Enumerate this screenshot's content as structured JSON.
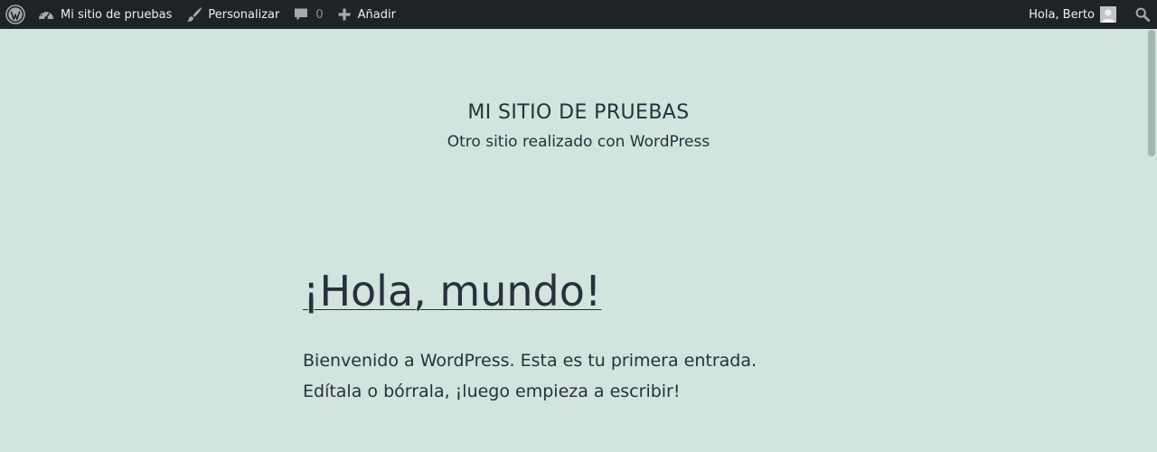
{
  "adminbar": {
    "site_name": "Mi sitio de pruebas",
    "customize": "Personalizar",
    "comments_count": "0",
    "new": "Añadir",
    "greeting": "Hola, Berto",
    "icons": {
      "logo": "wordpress-logo-icon",
      "site": "dashboard-icon",
      "customize": "brush-icon",
      "comments": "comment-icon",
      "new": "plus-icon",
      "avatar": "avatar-icon",
      "search": "search-icon"
    }
  },
  "site": {
    "title": "MI SITIO DE PRUEBAS",
    "description": "Otro sitio realizado con WordPress"
  },
  "post": {
    "title": "¡Hola, mundo!",
    "content": "Bienvenido a WordPress. Esta es tu primera entrada. Edítala o bórrala, ¡luego empieza a escribir!"
  },
  "colors": {
    "background": "#d1e4dd",
    "adminbar": "#1d2327",
    "text": "#28303d"
  }
}
